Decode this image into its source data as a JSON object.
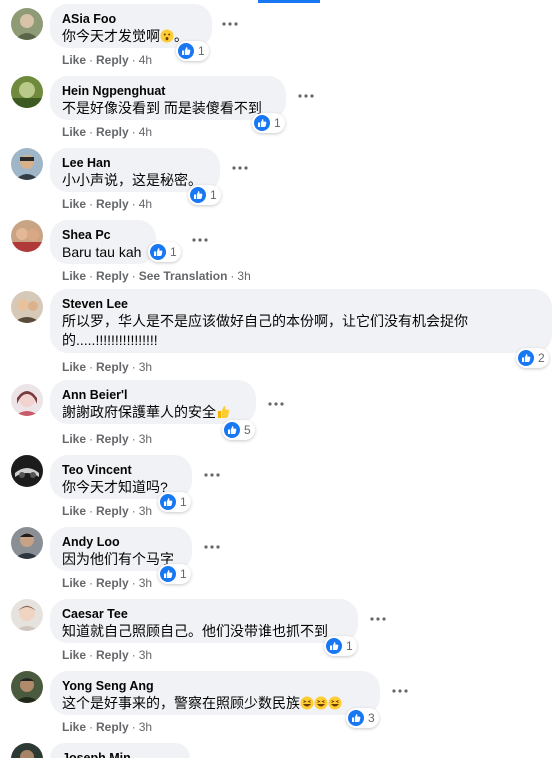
{
  "actions": {
    "like": "Like",
    "reply": "Reply",
    "see_translation": "See Translation",
    "separator": "·"
  },
  "comments": [
    {
      "author": "ASia Foo",
      "text": "你今天才发觉啊",
      "text_suffix": "。",
      "emoji": "astonished-face-icon",
      "reactions": "1",
      "time": "4h"
    },
    {
      "author": "Hein Ngpenghuat",
      "text": "不是好像没看到 而是装傻看不到",
      "reactions": "1",
      "time": "4h"
    },
    {
      "author": "Lee Han",
      "text": "小小声说，这是秘密。",
      "reactions": "1",
      "time": "4h"
    },
    {
      "author": "Shea Pc",
      "text": "Baru tau kah",
      "reactions": "1",
      "time": "3h"
    },
    {
      "author": "Steven Lee",
      "text": "所以罗，华人是不是应该做好自己的本份啊，让它们没有机会捉你的.....!!!!!!!!!!!!!!!!",
      "reactions": "2",
      "time": "3h"
    },
    {
      "author": "Ann Beier'l",
      "text": "謝謝政府保護華人的安全",
      "emoji": "thumbs-up-emoji-icon",
      "reactions": "5",
      "time": "3h"
    },
    {
      "author": "Teo Vincent",
      "text": "你今天才知道吗?",
      "reactions": "1",
      "time": "3h"
    },
    {
      "author": "Andy Loo",
      "text": "因为他们有个马字",
      "reactions": "1",
      "time": "3h"
    },
    {
      "author": "Caesar Tee",
      "text": "知道就自己照顾自己。他们没带谁也抓不到",
      "reactions": "1",
      "time": "3h"
    },
    {
      "author": "Yong Seng Ang",
      "text": "这个是好事来的，警察在照顾少数民族",
      "emoji": "grinning-squinting-face-icon",
      "reactions": "3",
      "time": "3h"
    },
    {
      "author": "Joseph Min"
    }
  ],
  "colors": {
    "like_blue": "#1877f2",
    "bubble": "#f0f2f5",
    "meta": "#65676b",
    "text": "#050505"
  },
  "icons": {
    "reaction": "like-reaction-icon",
    "menu": "more-options-icon"
  }
}
